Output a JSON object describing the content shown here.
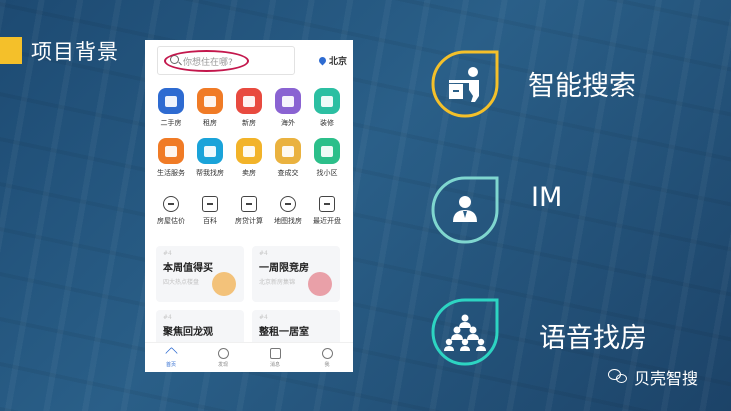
{
  "page": {
    "title": "项目背景",
    "accent_color": "#f4c02a"
  },
  "phone": {
    "search": {
      "placeholder": "你想住在哪?",
      "highlight_color": "#c3174c"
    },
    "location": "北京",
    "primary_tiles": [
      {
        "label": "二手房",
        "icon": "house-icon",
        "color": "#2e6bd1"
      },
      {
        "label": "租房",
        "icon": "building-icon",
        "color": "#f07b26"
      },
      {
        "label": "新房",
        "icon": "tower-icon",
        "color": "#e84a3f"
      },
      {
        "label": "海外",
        "icon": "plane-icon",
        "color": "#8a63d2"
      },
      {
        "label": "装修",
        "icon": "sofa-icon",
        "color": "#2cbfa2"
      },
      {
        "label": "生活服务",
        "icon": "truck-icon",
        "color": "#f07b26"
      },
      {
        "label": "帮我找房",
        "icon": "home-search-icon",
        "color": "#1aa3d9"
      },
      {
        "label": "卖房",
        "icon": "tag-icon",
        "color": "#f2b329"
      },
      {
        "label": "查成交",
        "icon": "hammer-icon",
        "color": "#eab23f"
      },
      {
        "label": "找小区",
        "icon": "apartment-icon",
        "color": "#2cbf8a"
      }
    ],
    "tools": [
      {
        "label": "房屋估价",
        "icon": "pie-icon"
      },
      {
        "label": "百科",
        "icon": "book-icon"
      },
      {
        "label": "房贷计算",
        "icon": "calculator-icon"
      },
      {
        "label": "地图找房",
        "icon": "map-pin-icon"
      },
      {
        "label": "最近开盘",
        "icon": "building-outline-icon"
      }
    ],
    "cards": [
      {
        "num": "#4",
        "title": "本周值得买",
        "sub": "四大热点楼盘",
        "art_color": "#f3c27a"
      },
      {
        "num": "#4",
        "title": "一周限竞房",
        "sub": "北京新房集锦",
        "art_color": "#e9a0a8"
      },
      {
        "num": "#4",
        "title": "聚焦回龙观",
        "sub": "",
        "art_color": ""
      },
      {
        "num": "#4",
        "title": "整租一居室",
        "sub": "",
        "art_color": ""
      }
    ],
    "tabbar": [
      {
        "label": "首页",
        "icon": "home-icon",
        "active": true
      },
      {
        "label": "发现",
        "icon": "discover-icon",
        "active": false
      },
      {
        "label": "消息",
        "icon": "message-icon",
        "active": false
      },
      {
        "label": "我",
        "icon": "profile-icon",
        "active": false
      }
    ]
  },
  "features": [
    {
      "label": "智能搜索",
      "icon": "person-at-desk-icon",
      "ring_color": "#f4c02a"
    },
    {
      "label": "IM",
      "icon": "person-icon",
      "ring_color": "#7fd6cf"
    },
    {
      "label": "语音找房",
      "icon": "group-icon",
      "ring_color": "#2dd4c2"
    }
  ],
  "footer": {
    "brand": "贝壳智搜",
    "icon": "wechat-icon"
  }
}
